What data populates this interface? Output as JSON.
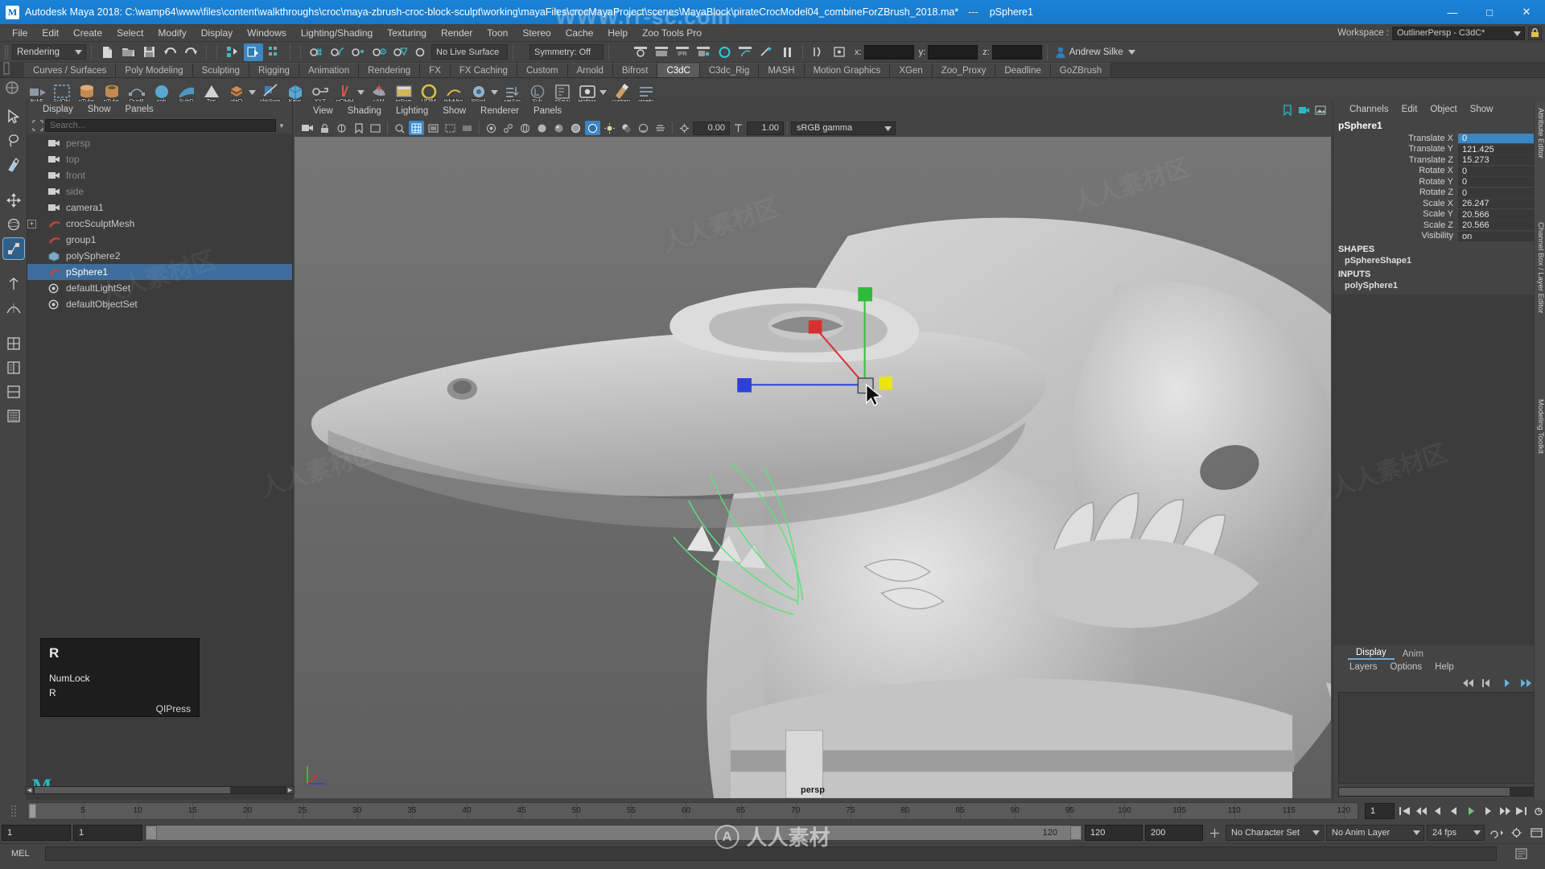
{
  "titlebar": {
    "app_title": "Autodesk Maya 2018: C:\\wamp64\\www\\files\\content\\walkthroughs\\croc\\maya-zbrush-croc-block-sculpt\\working\\mayaFiles\\crocMayaProject\\scenes\\MayaBlock\\pirateCrocModel04_combineForZBrush_2018.ma*",
    "separator": "---",
    "selection": "pSphere1",
    "logo": "M",
    "minimize": "—",
    "maximize": "□",
    "close": "✕"
  },
  "menubar": {
    "items": [
      "File",
      "Edit",
      "Create",
      "Select",
      "Modify",
      "Display",
      "Windows",
      "Lighting/Shading",
      "Texturing",
      "Render",
      "Toon",
      "Stereo",
      "Cache",
      "Help",
      "Zoo Tools Pro"
    ]
  },
  "workspace": {
    "label": "Workspace :",
    "value": "OutlinerPersp - C3dC*",
    "lock_icon": "lock-icon"
  },
  "statusline": {
    "menuset": "Rendering",
    "live_surface": "No Live Surface",
    "symmetry": "Symmetry: Off",
    "axis_x": "x:",
    "axis_y": "y:",
    "axis_z": "z:",
    "user": "Andrew Silke"
  },
  "shelf": {
    "tabs": [
      "Curves / Surfaces",
      "Poly Modeling",
      "Sculpting",
      "Rigging",
      "Animation",
      "Rendering",
      "FX",
      "FX Caching",
      "Custom",
      "Arnold",
      "Bifrost",
      "C3dC",
      "C3dc_Rig",
      "MASH",
      "Motion Graphics",
      "XGen",
      "Zoo_Proxy",
      "Deadline",
      "GoZBrush"
    ],
    "active_tab": "C3dC",
    "items": [
      {
        "label": "BckF",
        "color": "#8d9aa6"
      },
      {
        "label": "SclObj",
        "color": "#7d8b99"
      },
      {
        "label": "nTubs",
        "color": "#c38a52"
      },
      {
        "label": "pTubs",
        "color": "#c38a52"
      },
      {
        "label": "DupP",
        "color": "#8fa4b5"
      },
      {
        "label": "sph",
        "color": "#5aa7cf"
      },
      {
        "label": "SubD",
        "color": "#4f96c6"
      },
      {
        "label": "Tris",
        "color": "#b9bcc0"
      },
      {
        "label": "objQ",
        "color": "#d08a4e"
      },
      {
        "label": "chkSym",
        "color": "#3d7fb5"
      },
      {
        "label": "Keys",
        "color": "#5aa7cf"
      },
      {
        "label": "XYZ",
        "color": "#c8c8c8"
      },
      {
        "label": "nCtHH",
        "color": "#c16b5a"
      },
      {
        "label": "cAM",
        "color": "#9aa3ab"
      },
      {
        "label": "tgSwg",
        "color": "#d6b45a"
      },
      {
        "label": "UDIM",
        "color": "#4f96c6"
      },
      {
        "label": "tidyMrg",
        "color": "#6fa6cc"
      },
      {
        "label": "RSml",
        "color": "#9bb0c2"
      },
      {
        "label": "setArg",
        "color": "#8fa4b5"
      },
      {
        "label": "Sub",
        "color": "#86939f"
      },
      {
        "label": "zSavy",
        "color": "#b0b6bc"
      },
      {
        "label": "Hotbox",
        "color": "#d9d9d9"
      },
      {
        "label": "custom",
        "color": "#c9a16a"
      },
      {
        "label": "pipeln",
        "color": "#8fa4b5"
      }
    ]
  },
  "toolbox": {
    "tools": [
      "select-tool",
      "lasso-select-tool",
      "paint-select-tool",
      "move-tool",
      "rotate-tool",
      "scale-tool",
      "last-tool",
      "soft-mod-tool",
      "show-manipulator-tool",
      "sculpt-tool",
      "move-modes-tool",
      "layout-tool",
      "panel-layout-tool"
    ]
  },
  "outliner": {
    "menus": [
      "Display",
      "Show",
      "Panels"
    ],
    "search_placeholder": "Search...",
    "items": [
      {
        "label": "persp",
        "icon": "camera-icon",
        "dim": true,
        "expandable": false,
        "selected": false
      },
      {
        "label": "top",
        "icon": "camera-icon",
        "dim": true,
        "expandable": false,
        "selected": false
      },
      {
        "label": "front",
        "icon": "camera-icon",
        "dim": true,
        "expandable": false,
        "selected": false
      },
      {
        "label": "side",
        "icon": "camera-icon",
        "dim": true,
        "expandable": false,
        "selected": false
      },
      {
        "label": "camera1",
        "icon": "camera-icon",
        "dim": false,
        "expandable": false,
        "selected": false
      },
      {
        "label": "crocSculptMesh",
        "icon": "transform-icon",
        "dim": false,
        "expandable": true,
        "selected": false
      },
      {
        "label": "group1",
        "icon": "transform-icon",
        "dim": false,
        "expandable": false,
        "selected": false
      },
      {
        "label": "polySphere2",
        "icon": "poly-icon",
        "dim": false,
        "expandable": false,
        "selected": false
      },
      {
        "label": "pSphere1",
        "icon": "transform-icon",
        "dim": false,
        "expandable": false,
        "selected": true
      },
      {
        "label": "defaultLightSet",
        "icon": "set-icon",
        "dim": false,
        "expandable": false,
        "selected": false
      },
      {
        "label": "defaultObjectSet",
        "icon": "set-icon",
        "dim": false,
        "expandable": false,
        "selected": false
      }
    ]
  },
  "hotkey_popup": {
    "key": "R",
    "line1": "NumLock",
    "line2": "R",
    "line3": "QIPress"
  },
  "viewport": {
    "menus": [
      "View",
      "Shading",
      "Lighting",
      "Show",
      "Renderer",
      "Panels"
    ],
    "exposure": "0.00",
    "gamma": "1.00",
    "colorspace": "sRGB gamma",
    "camera_label": "persp",
    "manipulator": {
      "handle_x_color": "#2233dd",
      "handle_y_color": "#22cc22",
      "handle_z_color": "#dd2222",
      "center_color": "#e8e024"
    }
  },
  "channelbox": {
    "menus": [
      "Channels",
      "Edit",
      "Object",
      "Show"
    ],
    "node_name": "pSphere1",
    "attributes": [
      {
        "name": "Translate X",
        "value": "0",
        "highlight": true
      },
      {
        "name": "Translate Y",
        "value": "121.425",
        "highlight": false
      },
      {
        "name": "Translate Z",
        "value": "15.273",
        "highlight": false
      },
      {
        "name": "Rotate X",
        "value": "0",
        "highlight": false
      },
      {
        "name": "Rotate Y",
        "value": "0",
        "highlight": false
      },
      {
        "name": "Rotate Z",
        "value": "0",
        "highlight": false
      },
      {
        "name": "Scale X",
        "value": "26.247",
        "highlight": false
      },
      {
        "name": "Scale Y",
        "value": "20.566",
        "highlight": false
      },
      {
        "name": "Scale Z",
        "value": "20.566",
        "highlight": false
      },
      {
        "name": "Visibility",
        "value": "on",
        "highlight": false
      }
    ],
    "shapes_header": "SHAPES",
    "shapes_item": "pSphereShape1",
    "inputs_header": "INPUTS",
    "inputs_item": "polySphere1"
  },
  "layer_editor": {
    "tabs": [
      "Display",
      "Anim"
    ],
    "active_tab": "Display",
    "menus": [
      "Layers",
      "Options",
      "Help"
    ]
  },
  "right_edge_labels": [
    "Attribute Editor",
    "Channel Box / Layer Editor",
    "Modeling Toolkit"
  ],
  "timeslider": {
    "current_frame": "1",
    "start_field": "1",
    "range_start": "1",
    "range_max_label": "120",
    "ticks": [
      5,
      10,
      15,
      20,
      25,
      30,
      35,
      40,
      45,
      50,
      55,
      60,
      65,
      70,
      75,
      80,
      85,
      90,
      95,
      100,
      105,
      110,
      115,
      120
    ],
    "frame_field": "1"
  },
  "rangeslider": {
    "anim_start": "1",
    "anim_end": "120",
    "playback_end": "200",
    "character_set": "No Character Set",
    "anim_layer": "No Anim Layer",
    "fps": "24 fps"
  },
  "commandline": {
    "label": "MEL",
    "value": ""
  },
  "watermarks": {
    "top": "WWW.rr-sc.com",
    "bottom": "人人素材",
    "bottom_mark": "A",
    "tile": "人人素材区"
  }
}
